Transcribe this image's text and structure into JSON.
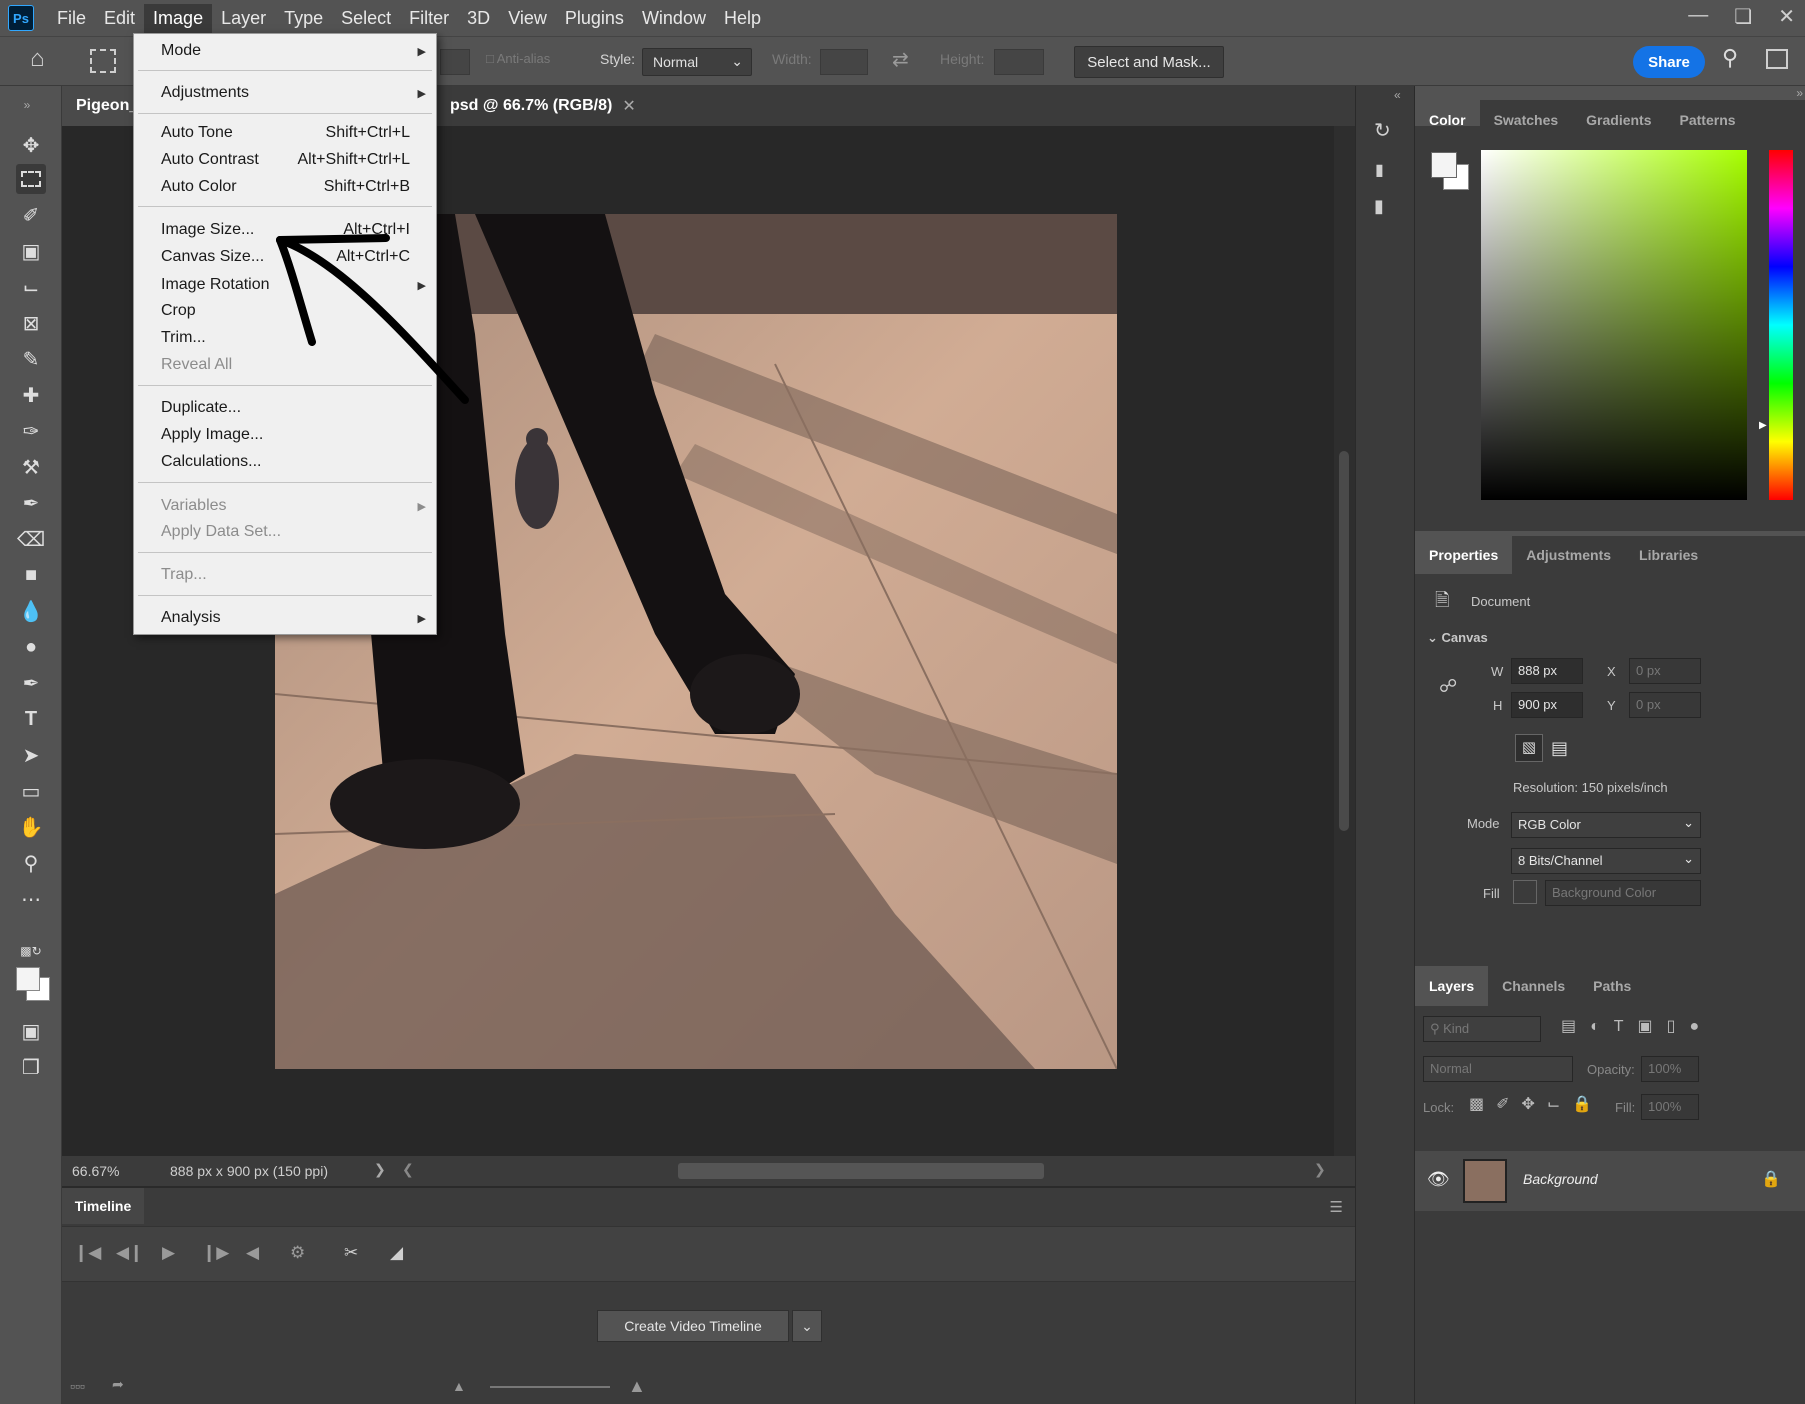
{
  "app": {
    "menus": [
      "File",
      "Edit",
      "Image",
      "Layer",
      "Type",
      "Select",
      "Filter",
      "3D",
      "View",
      "Plugins",
      "Window",
      "Help"
    ],
    "active_menu": "Image"
  },
  "options_bar": {
    "anti_alias": "Anti-alias",
    "style_label": "Style:",
    "style_value": "Normal",
    "width_label": "Width:",
    "height_label": "Height:",
    "select_mask": "Select and Mask...",
    "share": "Share"
  },
  "document": {
    "tab_left": "Pigeon_",
    "tab_right": "psd @ 66.7% (RGB/8)",
    "zoom": "66.67%",
    "info": "888 px x 900 px (150 ppi)"
  },
  "image_menu": {
    "mode": "Mode",
    "adjustments": "Adjustments",
    "auto_tone": "Auto Tone",
    "auto_tone_sc": "Shift+Ctrl+L",
    "auto_contrast": "Auto Contrast",
    "auto_contrast_sc": "Alt+Shift+Ctrl+L",
    "auto_color": "Auto Color",
    "auto_color_sc": "Shift+Ctrl+B",
    "image_size": "Image Size...",
    "image_size_sc": "Alt+Ctrl+I",
    "canvas_size": "Canvas Size...",
    "canvas_size_sc": "Alt+Ctrl+C",
    "image_rotation": "Image Rotation",
    "crop": "Crop",
    "trim": "Trim...",
    "reveal_all": "Reveal All",
    "duplicate": "Duplicate...",
    "apply_image": "Apply Image...",
    "calculations": "Calculations...",
    "variables": "Variables",
    "apply_data_set": "Apply Data Set...",
    "trap": "Trap...",
    "analysis": "Analysis"
  },
  "timeline": {
    "tab": "Timeline",
    "create_video": "Create Video Timeline"
  },
  "color_panel": {
    "tabs": [
      "Color",
      "Swatches",
      "Gradients",
      "Patterns"
    ]
  },
  "properties_panel": {
    "tabs": [
      "Properties",
      "Adjustments",
      "Libraries"
    ],
    "document_label": "Document",
    "canvas_label": "Canvas",
    "w_label": "W",
    "w_value": "888 px",
    "h_label": "H",
    "h_value": "900 px",
    "x_label": "X",
    "x_value": "0 px",
    "y_label": "Y",
    "y_value": "0 px",
    "resolution": "Resolution: 150 pixels/inch",
    "mode_label": "Mode",
    "mode_value": "RGB Color",
    "bits_value": "8 Bits/Channel",
    "fill_label": "Fill",
    "fill_value": "Background Color"
  },
  "layers_panel": {
    "tabs": [
      "Layers",
      "Channels",
      "Paths"
    ],
    "kind_placeholder": "Kind",
    "blend_mode": "Normal",
    "opacity_label": "Opacity:",
    "opacity_value": "100%",
    "lock_label": "Lock:",
    "fill_label": "Fill:",
    "fill_value": "100%",
    "layer_name": "Background"
  },
  "colors": {
    "accent": "#1473e6",
    "chrome": "#535353",
    "panel": "#3b3b3b",
    "canvas_bg": "#282828"
  }
}
